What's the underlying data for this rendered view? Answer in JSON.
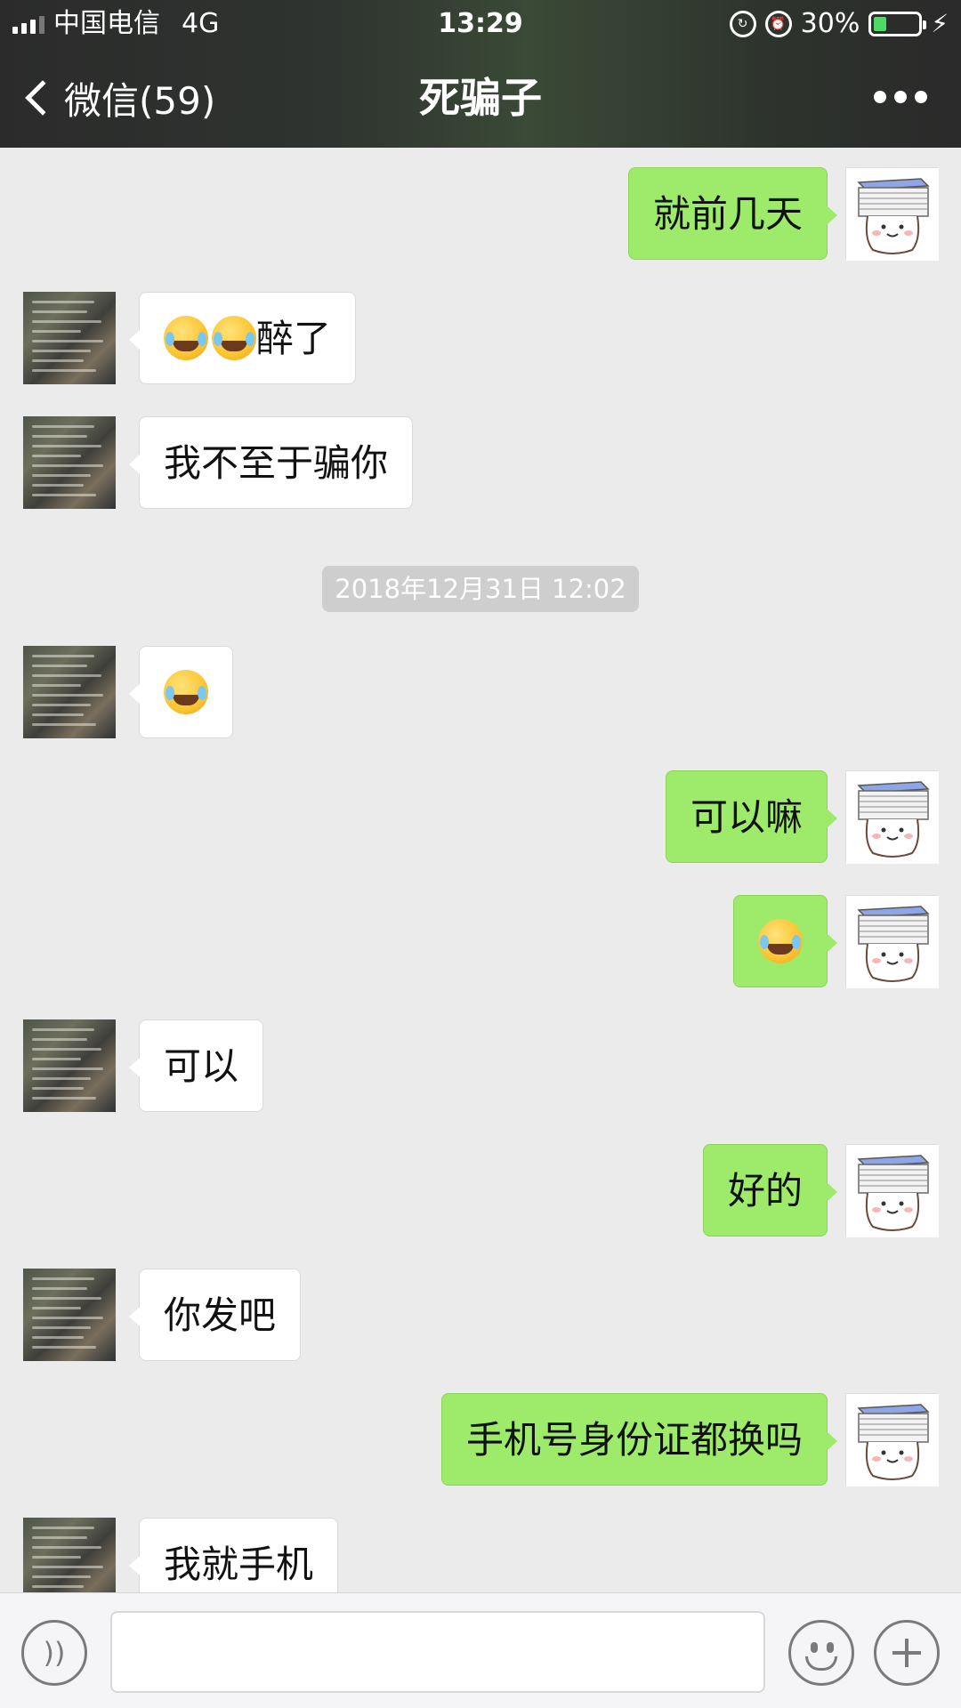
{
  "status": {
    "carrier": "中国电信",
    "network": "4G",
    "time": "13:29",
    "battery": "30%",
    "battery_level": 0.3
  },
  "nav": {
    "back_label": "微信(59)",
    "title": "死骗子"
  },
  "timestamp": "2018年12月31日 12:02",
  "messages": [
    {
      "side": "right",
      "text": "就前几天"
    },
    {
      "side": "left",
      "emoji_count": 2,
      "text": "醉了"
    },
    {
      "side": "left",
      "text": "我不至于骗你"
    },
    {
      "side": "left",
      "emoji_count": 1,
      "text": ""
    },
    {
      "side": "right",
      "text": "可以嘛"
    },
    {
      "side": "right",
      "emoji_count": 1,
      "text": ""
    },
    {
      "side": "left",
      "text": "可以"
    },
    {
      "side": "right",
      "text": "好的"
    },
    {
      "side": "left",
      "text": "你发吧"
    },
    {
      "side": "right",
      "text": "手机号身份证都换吗"
    },
    {
      "side": "left",
      "text": "我就手机"
    }
  ],
  "input": {
    "value": "",
    "placeholder": ""
  },
  "colors": {
    "bubble_self": "#9eea6a",
    "bubble_other": "#ffffff",
    "chat_bg": "#ebebeb"
  }
}
